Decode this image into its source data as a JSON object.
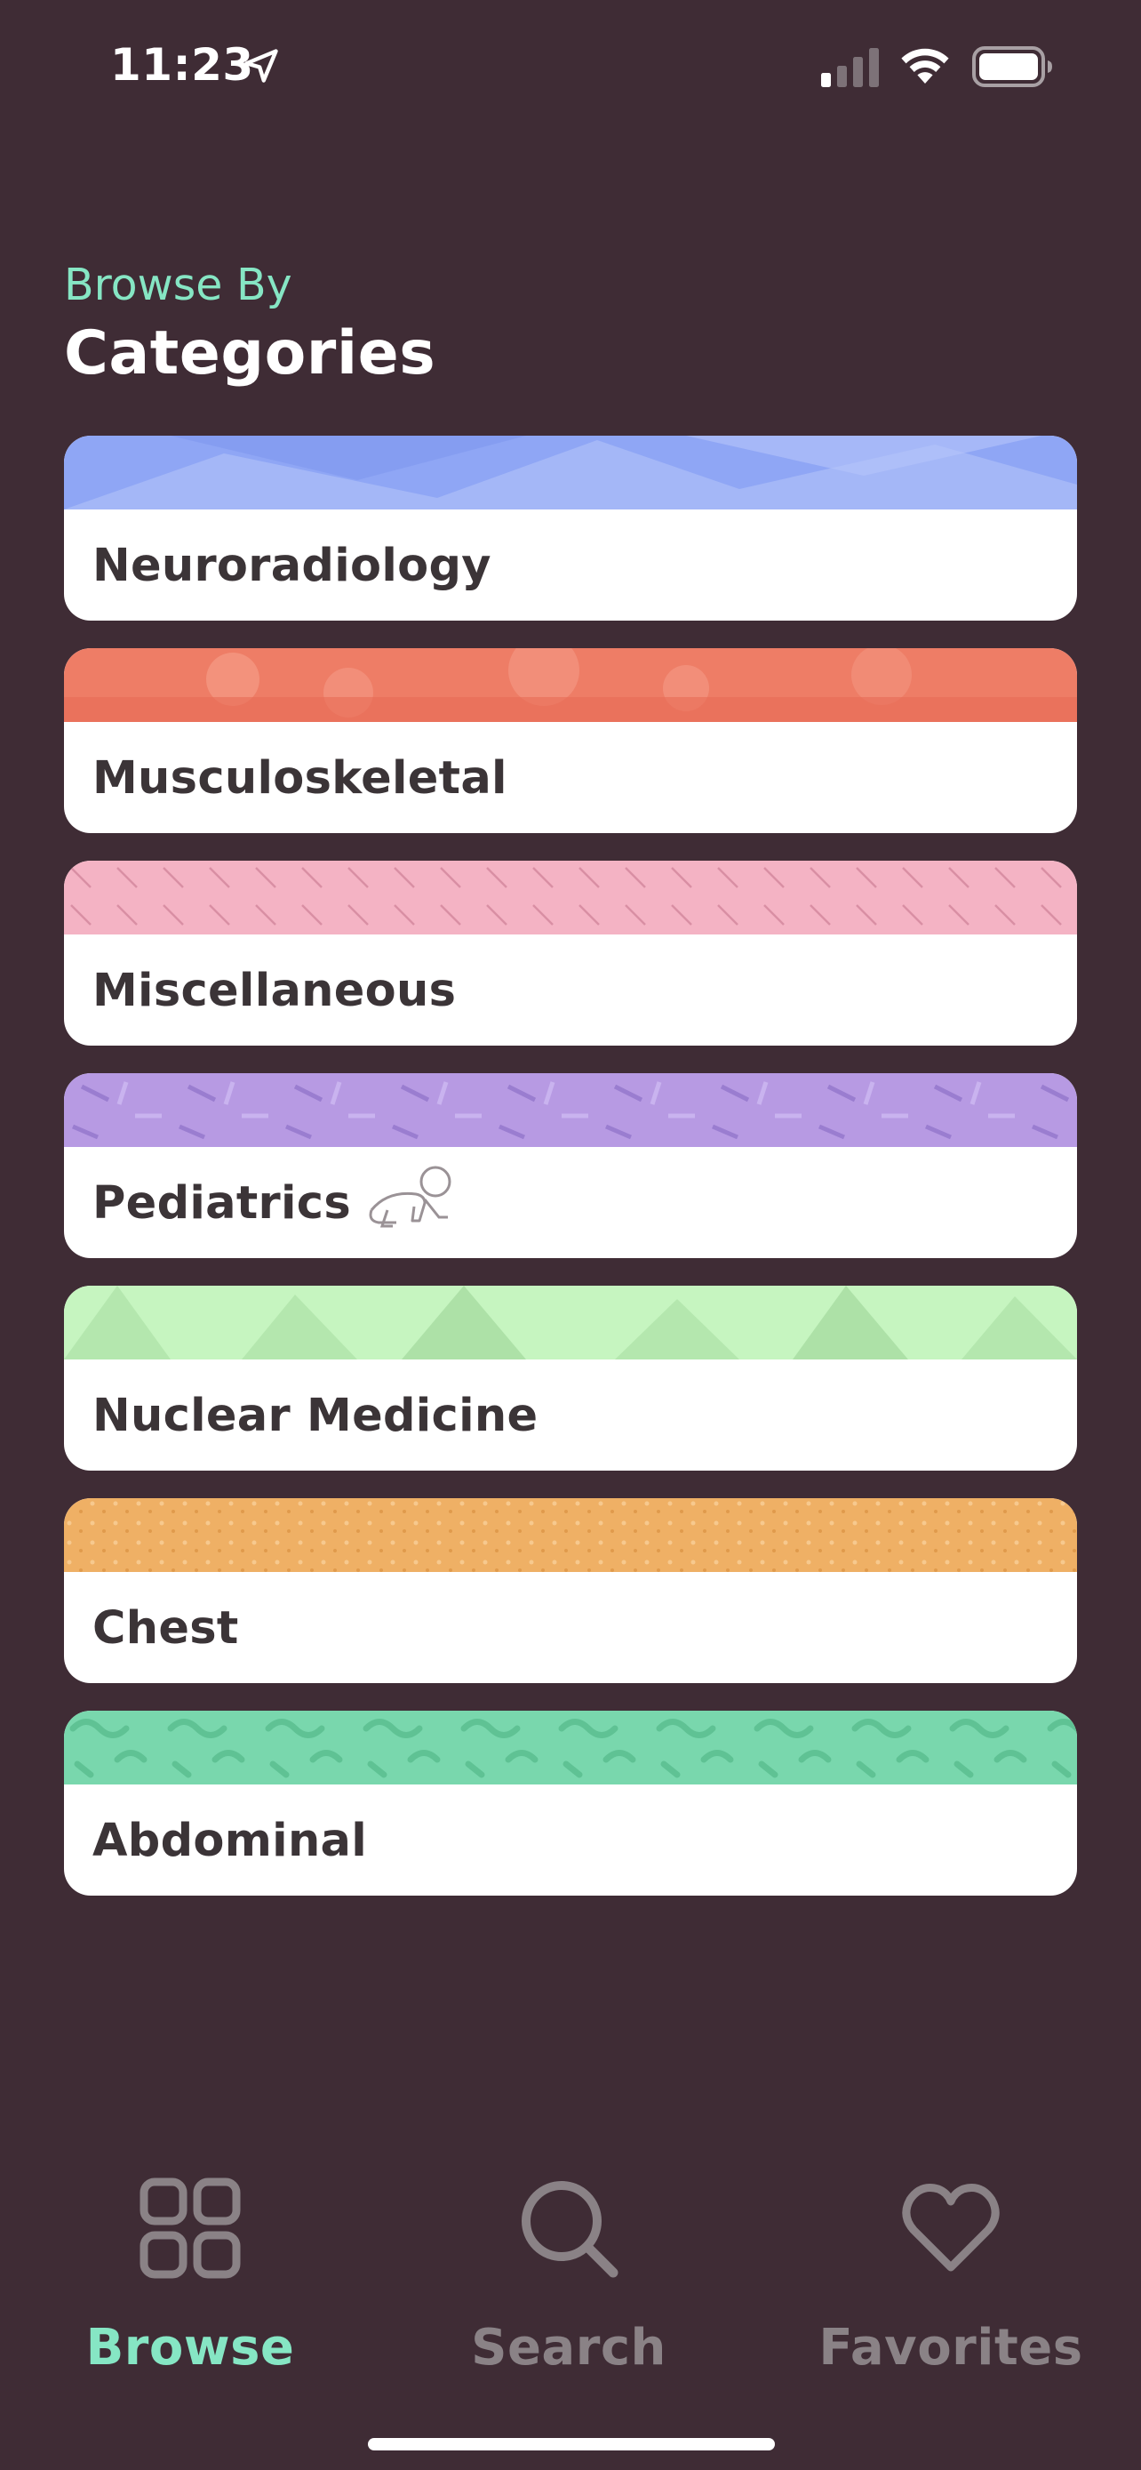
{
  "status_bar": {
    "time": "11:23",
    "icons": [
      "location-arrow-icon",
      "cellular-signal-icon",
      "wifi-icon",
      "battery-icon"
    ]
  },
  "header": {
    "eyebrow": "Browse By",
    "title": "Categories"
  },
  "categories": [
    {
      "label": "Neuroradiology",
      "color": "#8fa6f5"
    },
    {
      "label": "Musculoskeletal",
      "color": "#ee7d66"
    },
    {
      "label": "Miscellaneous",
      "color": "#f4b3c4"
    },
    {
      "label": "Pediatrics",
      "color": "#b79ae3",
      "icon": "crawling-baby-icon"
    },
    {
      "label": "Nuclear Medicine",
      "color": "#c6f5c0"
    },
    {
      "label": "Chest",
      "color": "#efb065"
    },
    {
      "label": "Abdominal",
      "color": "#79d7ad"
    }
  ],
  "tab_bar": {
    "tabs": [
      {
        "label": "Browse",
        "icon": "grid-icon",
        "active": true
      },
      {
        "label": "Search",
        "icon": "search-icon",
        "active": false
      },
      {
        "label": "Favorites",
        "icon": "heart-icon",
        "active": false
      }
    ],
    "active_color": "#86e6c4",
    "inactive_color": "#8a8286"
  },
  "colors": {
    "background": "#3f2c35",
    "card": "#ffffff",
    "card_text": "#3b3437"
  }
}
